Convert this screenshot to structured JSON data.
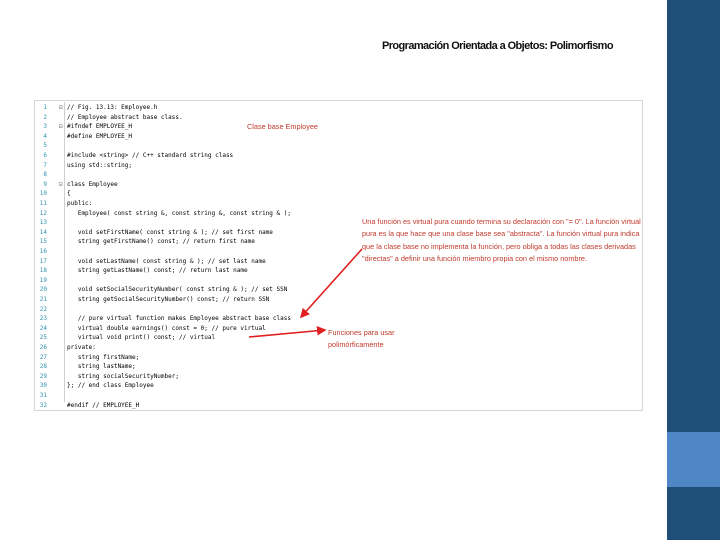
{
  "slide": {
    "title": "Programación Orientada a Objetos: Polimorfismo",
    "colors": {
      "sidebar_dark": "#1f4e79",
      "sidebar_light": "#4f86c6",
      "annotation": "#c0392b",
      "arrow": "#e02020"
    }
  },
  "code": {
    "lines": [
      {
        "num": "1",
        "fold": "⊟",
        "text": "// Fig. 13.13: Employee.h"
      },
      {
        "num": "2",
        "fold": "",
        "text": "// Employee abstract base class."
      },
      {
        "num": "3",
        "fold": "⊟",
        "text": "#ifndef EMPLOYEE_H"
      },
      {
        "num": "4",
        "fold": "",
        "text": "#define EMPLOYEE_H"
      },
      {
        "num": "5",
        "fold": "",
        "text": ""
      },
      {
        "num": "6",
        "fold": "",
        "text": "#include <string> // C++ standard string class"
      },
      {
        "num": "7",
        "fold": "",
        "text": "using std::string;"
      },
      {
        "num": "8",
        "fold": "",
        "text": ""
      },
      {
        "num": "9",
        "fold": "⊟",
        "text": "class Employee"
      },
      {
        "num": "10",
        "fold": "",
        "text": "{"
      },
      {
        "num": "11",
        "fold": "",
        "text": "public:"
      },
      {
        "num": "12",
        "fold": "",
        "text": "   Employee( const string &, const string &, const string & );"
      },
      {
        "num": "13",
        "fold": "",
        "text": ""
      },
      {
        "num": "14",
        "fold": "",
        "text": "   void setFirstName( const string & ); // set first name"
      },
      {
        "num": "15",
        "fold": "",
        "text": "   string getFirstName() const; // return first name"
      },
      {
        "num": "16",
        "fold": "",
        "text": ""
      },
      {
        "num": "17",
        "fold": "",
        "text": "   void setLastName( const string & ); // set last name"
      },
      {
        "num": "18",
        "fold": "",
        "text": "   string getLastName() const; // return last name"
      },
      {
        "num": "19",
        "fold": "",
        "text": ""
      },
      {
        "num": "20",
        "fold": "",
        "text": "   void setSocialSecurityNumber( const string & ); // set SSN"
      },
      {
        "num": "21",
        "fold": "",
        "text": "   string getSocialSecurityNumber() const; // return SSN"
      },
      {
        "num": "22",
        "fold": "",
        "text": ""
      },
      {
        "num": "23",
        "fold": "",
        "text": "   // pure virtual function makes Employee abstract base class"
      },
      {
        "num": "24",
        "fold": "",
        "text": "   virtual double earnings() const = 0; // pure virtual"
      },
      {
        "num": "25",
        "fold": "",
        "text": "   virtual void print() const; // virtual"
      },
      {
        "num": "26",
        "fold": "",
        "text": "private:"
      },
      {
        "num": "27",
        "fold": "",
        "text": "   string firstName;"
      },
      {
        "num": "28",
        "fold": "",
        "text": "   string lastName;"
      },
      {
        "num": "29",
        "fold": "",
        "text": "   string socialSecurityNumber;"
      },
      {
        "num": "30",
        "fold": "",
        "text": "}; // end class Employee"
      },
      {
        "num": "31",
        "fold": "",
        "text": ""
      },
      {
        "num": "32",
        "fold": "",
        "text": "#endif // EMPLOYEE_H"
      }
    ]
  },
  "annotations": {
    "base_class": "Clase base Employee",
    "pure_virtual": "Una función es virtual pura cuando termina su declaración con \"= 0\". La función virtual pura es la que hace que una clase base sea \"abstracta\". La función virtual pura indica que la clase base no implementa la función, pero obliga a todas las clases derivadas \"directas\" a definir una función miembro propia con el mismo nombre.",
    "polymorphism": "Funciones para usar polimórficamente"
  }
}
